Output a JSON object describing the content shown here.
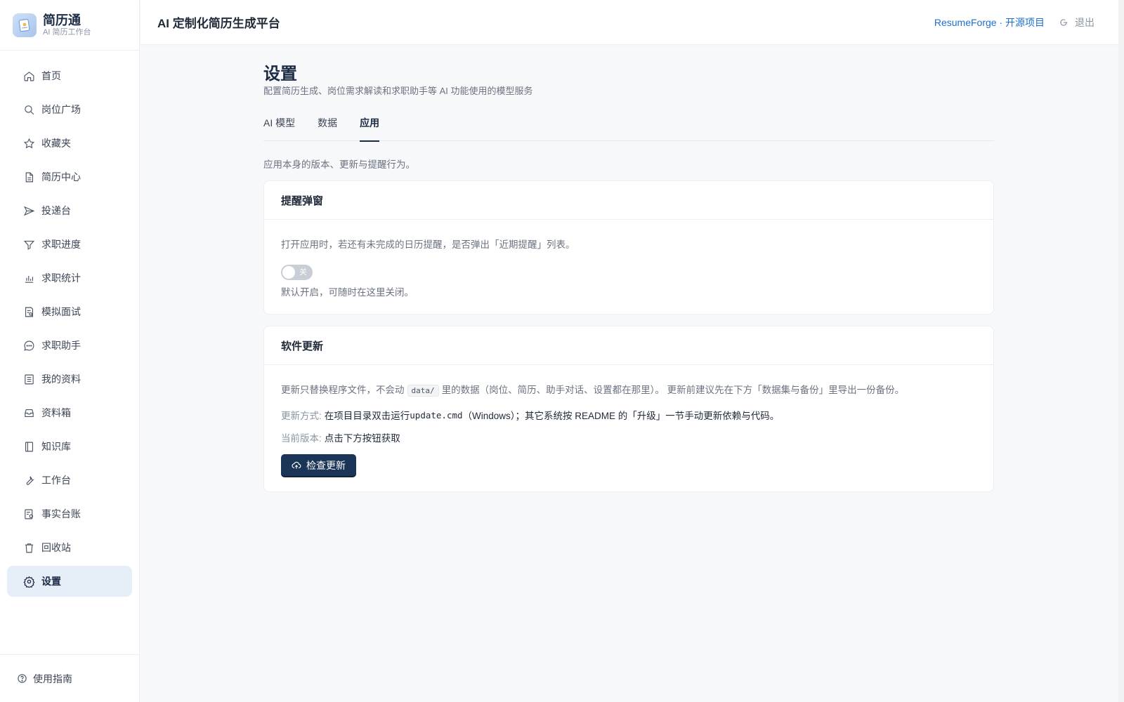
{
  "brand": {
    "name": "简历通",
    "subtitle": "AI 简历工作台"
  },
  "sidebar": {
    "items": [
      {
        "label": "首页",
        "icon": "home-icon"
      },
      {
        "label": "岗位广场",
        "icon": "search-icon"
      },
      {
        "label": "收藏夹",
        "icon": "star-icon"
      },
      {
        "label": "简历中心",
        "icon": "document-icon"
      },
      {
        "label": "投递台",
        "icon": "send-icon"
      },
      {
        "label": "求职进度",
        "icon": "funnel-icon"
      },
      {
        "label": "求职统计",
        "icon": "bar-chart-icon"
      },
      {
        "label": "模拟面试",
        "icon": "interview-icon"
      },
      {
        "label": "求职助手",
        "icon": "chat-icon"
      },
      {
        "label": "我的资料",
        "icon": "profile-list-icon"
      },
      {
        "label": "资料箱",
        "icon": "inbox-icon"
      },
      {
        "label": "知识库",
        "icon": "book-icon"
      },
      {
        "label": "工作台",
        "icon": "wrench-icon"
      },
      {
        "label": "事实台账",
        "icon": "ledger-icon"
      },
      {
        "label": "回收站",
        "icon": "trash-icon"
      },
      {
        "label": "设置",
        "icon": "gear-icon",
        "active": true
      }
    ],
    "footer_label": "使用指南"
  },
  "header": {
    "title": "AI 定制化简历生成平台",
    "github_link": "ResumeForge · 开源项目",
    "logout_label": "退出"
  },
  "page": {
    "title": "设置",
    "subtitle": "配置简历生成、岗位需求解读和求职助手等 AI 功能使用的模型服务",
    "tabs": [
      {
        "label": "AI 模型"
      },
      {
        "label": "数据"
      },
      {
        "label": "应用",
        "active": true
      }
    ],
    "section_desc": "应用本身的版本、更新与提醒行为。"
  },
  "reminder_card": {
    "title": "提醒弹窗",
    "description": "打开应用时，若还有未完成的日历提醒，是否弹出「近期提醒」列表。",
    "toggle_text": "关",
    "toggle_on": false,
    "hint": "默认开启，可随时在这里关闭。"
  },
  "update_card": {
    "title": "软件更新",
    "desc_before": "更新只替换程序文件，不会动",
    "code": "data/",
    "desc_after": "里的数据（岗位、简历、助手对话、设置都在那里）。 更新前建议先在下方「数据集与备份」里导出一份备份。",
    "method_label": "更新方式:",
    "method_text_a": "在项目目录双击运行",
    "method_cmd": "update.cmd",
    "method_text_b": "（Windows）；其它系统按 README 的「升级」一节手动更新依赖与代码。",
    "version_label": "当前版本:",
    "version_value": "点击下方按钮获取",
    "button_label": "检查更新"
  },
  "colors": {
    "primary": "#1b3556",
    "active_bg": "#e6eef8",
    "link": "#1e6fd0"
  }
}
